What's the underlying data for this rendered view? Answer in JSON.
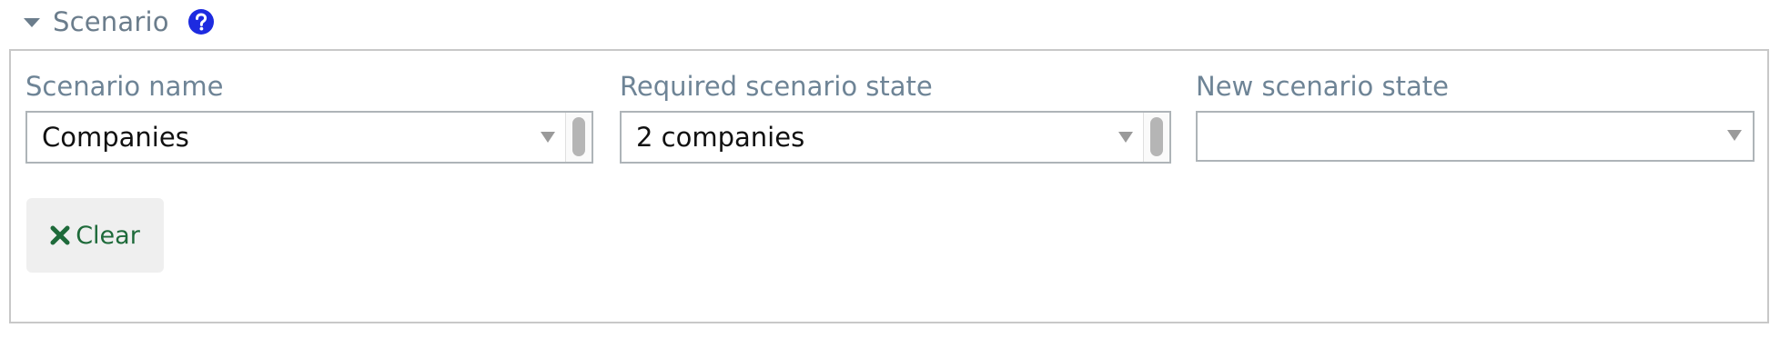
{
  "section": {
    "title": "Scenario",
    "help_icon": "question-circle-icon",
    "toggle_icon": "caret-down-icon"
  },
  "fields": {
    "scenario_name": {
      "label": "Scenario name",
      "value": "Companies"
    },
    "required_state": {
      "label": "Required scenario state",
      "value": "2 companies"
    },
    "new_state": {
      "label": "New scenario state",
      "value": ""
    }
  },
  "clear_button": {
    "label": "Clear",
    "icon": "x-icon"
  },
  "colors": {
    "label": "#6e8496",
    "help_icon": "#1d2be0",
    "clear_text": "#1e6a3a",
    "panel_border": "#c8c8c8"
  }
}
